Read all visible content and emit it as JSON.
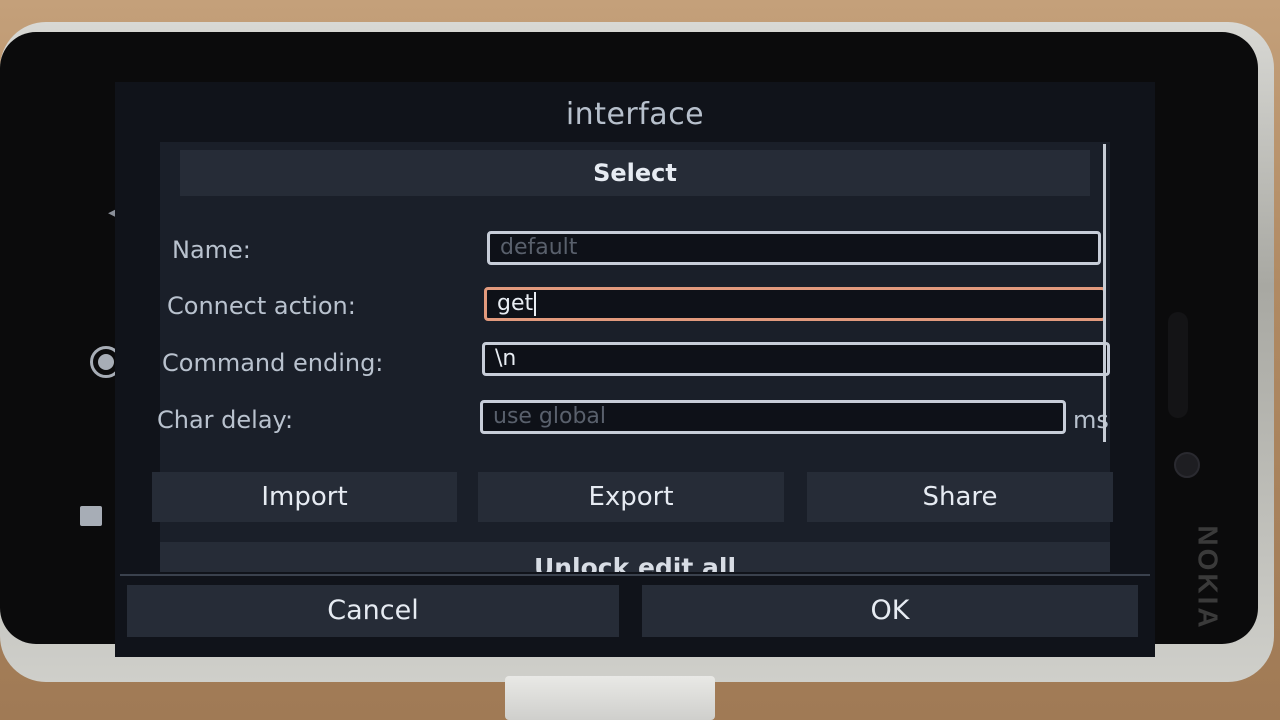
{
  "dialog": {
    "title": "interface",
    "select_label": "Select"
  },
  "form": {
    "name": {
      "label": "Name:",
      "value": "",
      "placeholder": "default"
    },
    "connect_action": {
      "label": "Connect action:",
      "value": "get",
      "placeholder": ""
    },
    "command_ending": {
      "label": "Command ending:",
      "value": "\\n",
      "placeholder": ""
    },
    "char_delay": {
      "label": "Char delay:",
      "value": "",
      "placeholder": "use global",
      "unit": "ms"
    }
  },
  "actions": {
    "import_label": "Import",
    "export_label": "Export",
    "share_label": "Share",
    "unlock_label": "Unlock edit all"
  },
  "footer": {
    "cancel_label": "Cancel",
    "ok_label": "OK"
  },
  "device": {
    "brand": "NOKIA"
  },
  "colors": {
    "focused_border": "#e29a7d",
    "field_border": "#c7cdd8",
    "button_bg": "#262c37",
    "screen_bg": "#10131a"
  }
}
